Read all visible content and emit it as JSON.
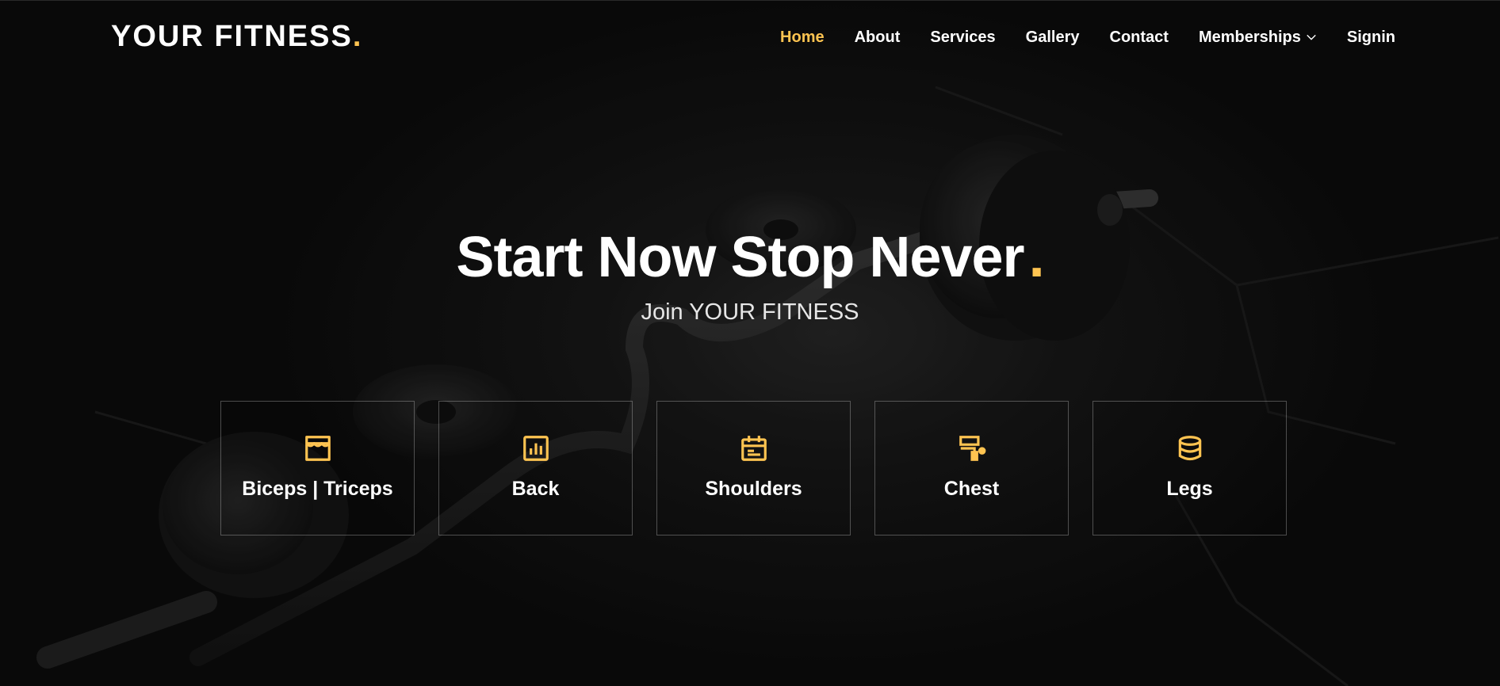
{
  "brand": {
    "name": "YOUR FITNESS",
    "dot": ".",
    "accent_color": "#ffc451"
  },
  "nav": {
    "items": [
      {
        "label": "Home",
        "active": true
      },
      {
        "label": "About",
        "active": false
      },
      {
        "label": "Services",
        "active": false
      },
      {
        "label": "Gallery",
        "active": false
      },
      {
        "label": "Contact",
        "active": false
      },
      {
        "label": "Memberships",
        "active": false,
        "icon": "chevron-down-icon"
      },
      {
        "label": "Signin",
        "active": false
      }
    ]
  },
  "hero": {
    "title": "Start Now Stop Never",
    "title_dot": ".",
    "subtitle": "Join YOUR FITNESS",
    "background": "dark gym floor with curl barbell",
    "boxes": [
      {
        "label": "Biceps | Triceps",
        "icon": "store-icon"
      },
      {
        "label": "Back",
        "icon": "bar-chart-icon"
      },
      {
        "label": "Shoulders",
        "icon": "calendar-icon"
      },
      {
        "label": "Chest",
        "icon": "paint-roller-icon"
      },
      {
        "label": "Legs",
        "icon": "database-icon"
      }
    ]
  }
}
